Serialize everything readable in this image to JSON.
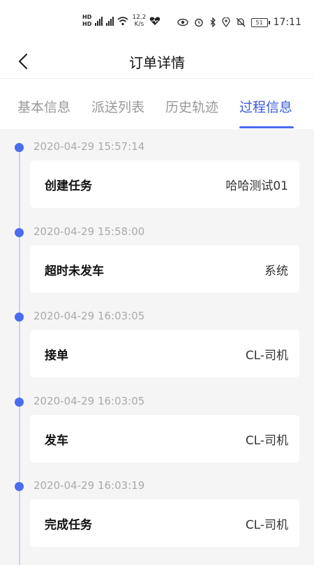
{
  "status_bar": {
    "net_rate": "12.2",
    "net_unit": "K/s",
    "battery": "51",
    "time": "17:11"
  },
  "header": {
    "title": "订单详情"
  },
  "tabs": [
    {
      "label": "基本信息"
    },
    {
      "label": "派送列表"
    },
    {
      "label": "历史轨迹"
    },
    {
      "label": "过程信息"
    }
  ],
  "timeline": [
    {
      "time": "2020-04-29 15:57:14",
      "action": "创建任务",
      "operator": "哈哈测试01"
    },
    {
      "time": "2020-04-29 15:58:00",
      "action": "超时未发车",
      "operator": "系统"
    },
    {
      "time": "2020-04-29 16:03:05",
      "action": "接单",
      "operator": "CL-司机"
    },
    {
      "time": "2020-04-29 16:03:05",
      "action": "发车",
      "operator": "CL-司机"
    },
    {
      "time": "2020-04-29 16:03:19",
      "action": "完成任务",
      "operator": "CL-司机"
    }
  ]
}
